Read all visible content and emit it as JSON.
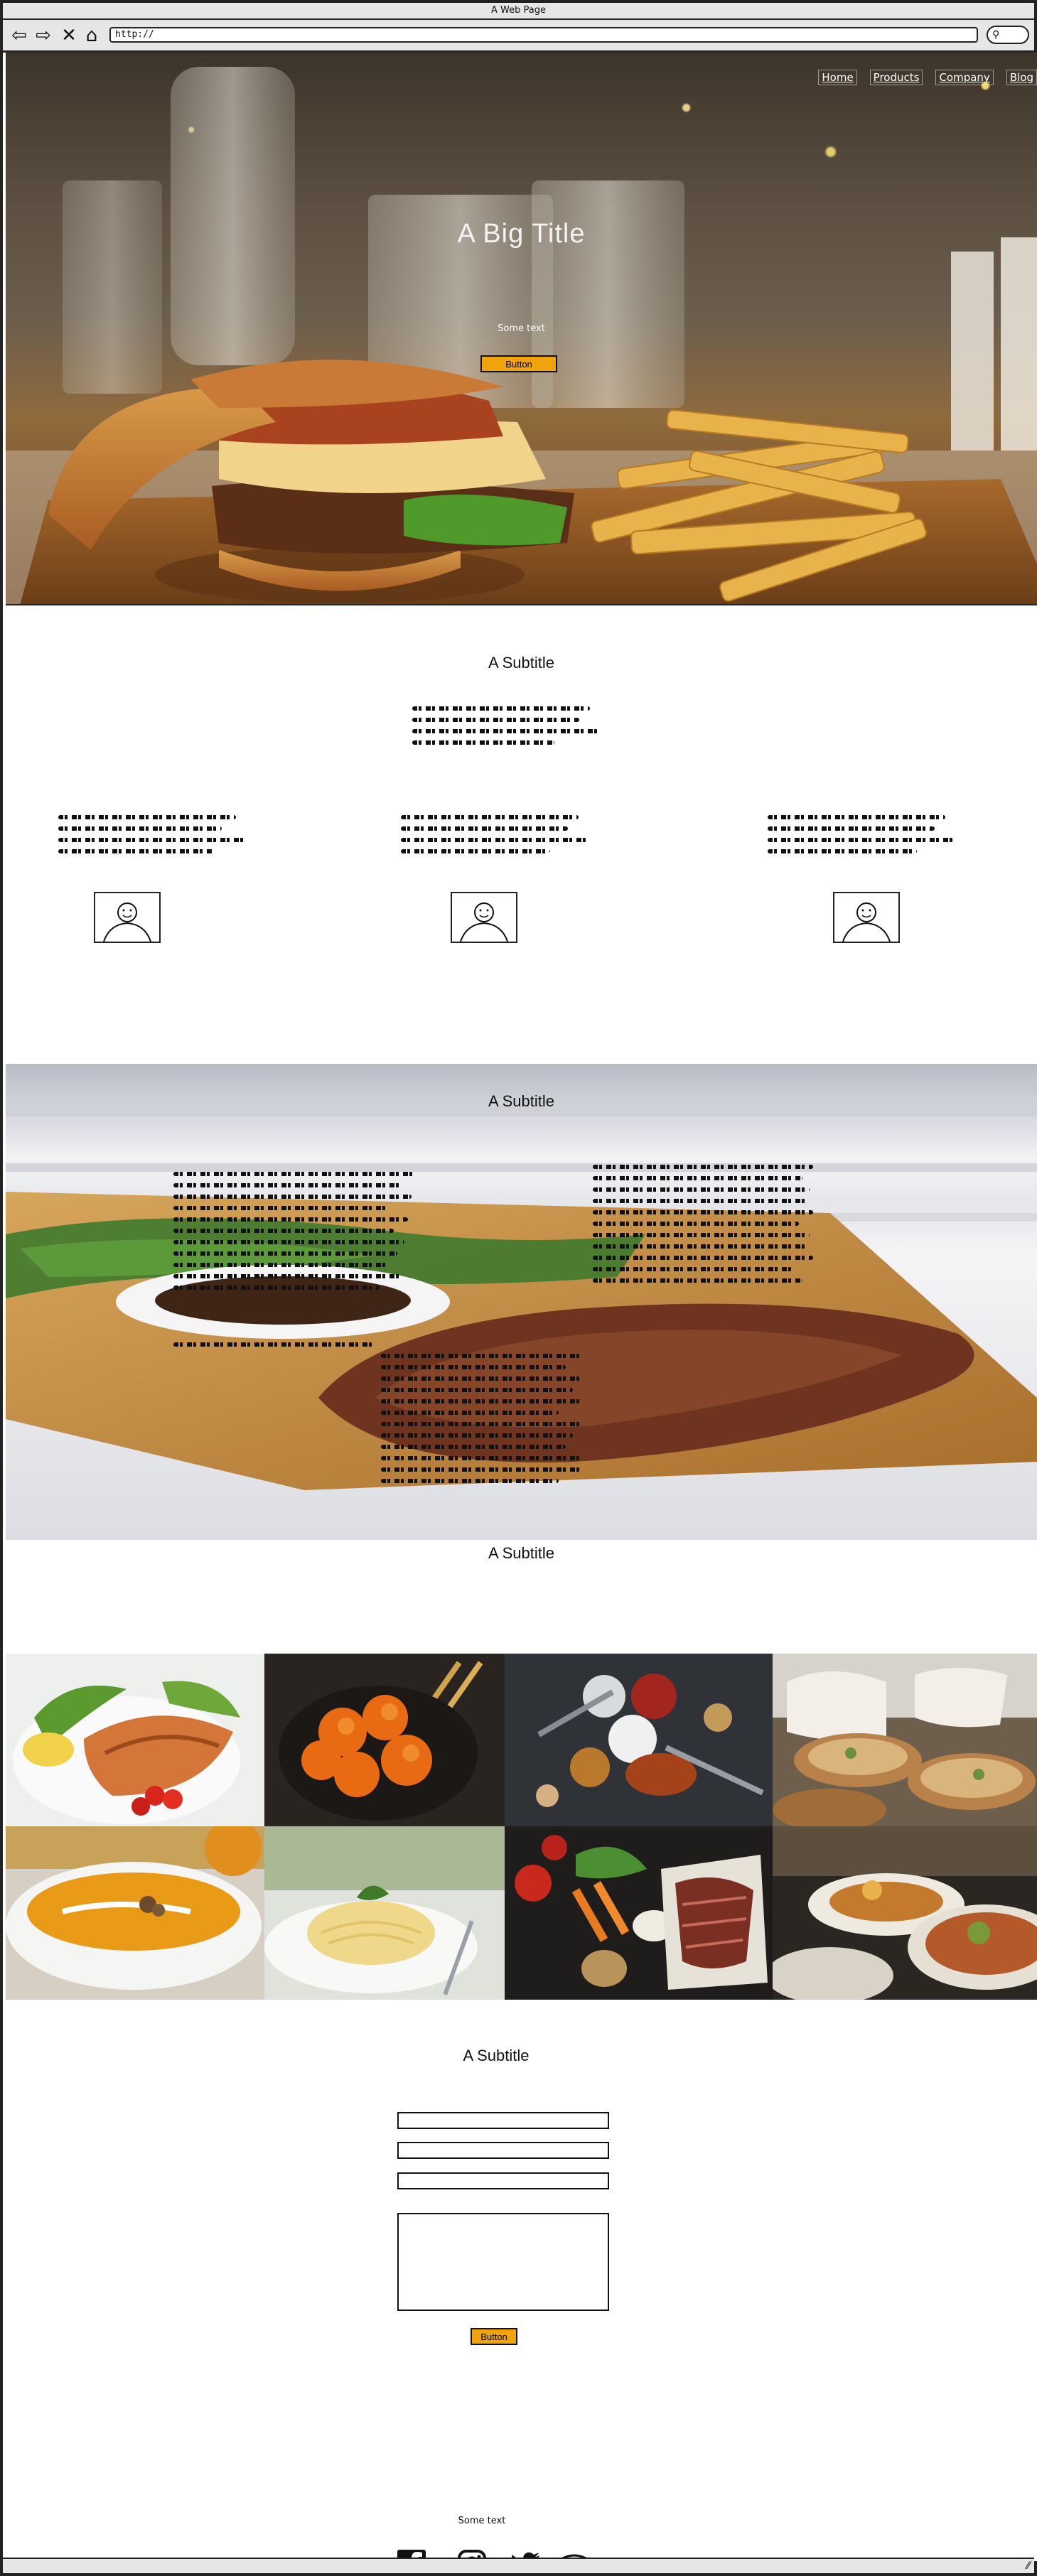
{
  "browser": {
    "title": "A Web Page",
    "url": "http://"
  },
  "nav": {
    "items": [
      "Home",
      "Products",
      "Company",
      "Blog"
    ]
  },
  "hero": {
    "title": "A Big Title",
    "text": "Some text",
    "button": "Button"
  },
  "section1": {
    "subtitle": "A Subtitle"
  },
  "section2": {
    "subtitle": "A Subtitle"
  },
  "section3": {
    "subtitle": "A Subtitle"
  },
  "contact": {
    "subtitle": "A Subtitle",
    "button": "Button"
  },
  "footer": {
    "text": "Some text",
    "social": [
      "facebook-icon",
      "instagram-icon",
      "twitter-icon",
      "tripadvisor-icon"
    ]
  },
  "colors": {
    "button": "#f0a30a",
    "border": "#222222"
  }
}
